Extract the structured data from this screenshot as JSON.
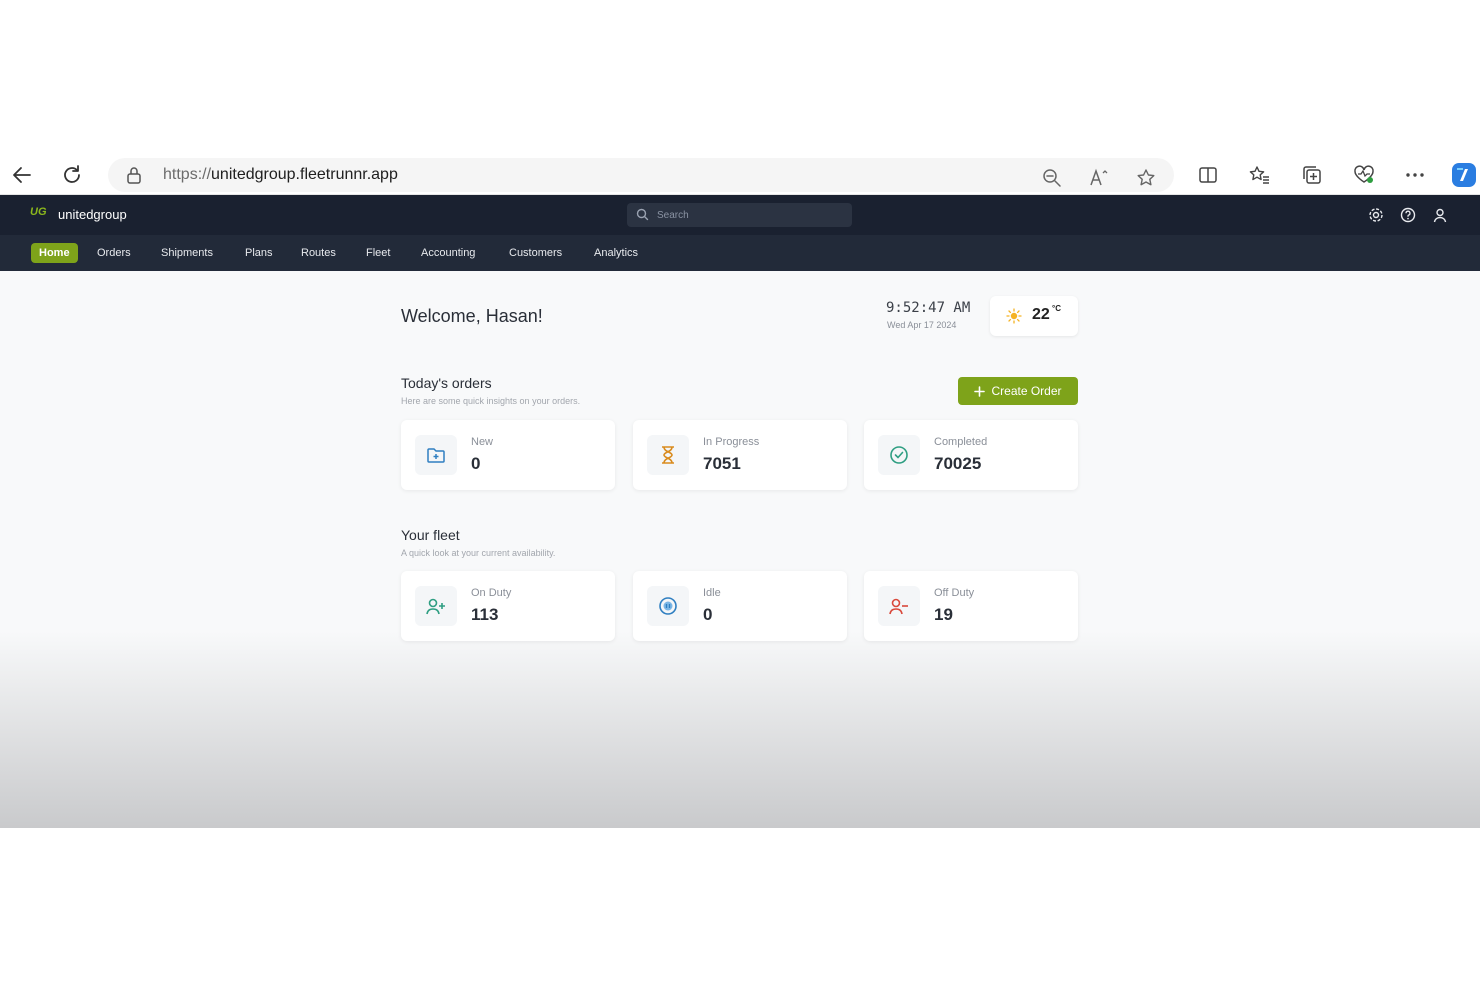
{
  "browser": {
    "url_scheme": "https://",
    "url_host": "unitedgroup.fleetrunnr.app"
  },
  "app": {
    "logo_text": "UG",
    "brand": "unitedgroup",
    "search_placeholder": "Search"
  },
  "nav": {
    "items": [
      {
        "label": "Home",
        "active": true
      },
      {
        "label": "Orders",
        "active": false
      },
      {
        "label": "Shipments",
        "active": false
      },
      {
        "label": "Plans",
        "active": false
      },
      {
        "label": "Routes",
        "active": false
      },
      {
        "label": "Fleet",
        "active": false
      },
      {
        "label": "Accounting",
        "active": false
      },
      {
        "label": "Customers",
        "active": false
      },
      {
        "label": "Analytics",
        "active": false
      }
    ]
  },
  "dashboard": {
    "welcome": "Welcome, Hasan!",
    "time": "9:52:47 AM",
    "date": "Wed Apr 17 2024",
    "weather": {
      "temp": "22",
      "unit": "°C",
      "icon": "sun-icon"
    },
    "orders": {
      "title": "Today's orders",
      "subtitle": "Here are some quick insights on your orders.",
      "create_label": "Create Order",
      "cards": [
        {
          "label": "New",
          "value": "0",
          "icon": "folder-plus-icon",
          "color": "#2f7fc1"
        },
        {
          "label": "In Progress",
          "value": "7051",
          "icon": "hourglass-icon",
          "color": "#d98b1e"
        },
        {
          "label": "Completed",
          "value": "70025",
          "icon": "check-circle-icon",
          "color": "#2e9e82"
        }
      ]
    },
    "fleet": {
      "title": "Your fleet",
      "subtitle": "A quick look at your current availability.",
      "cards": [
        {
          "label": "On Duty",
          "value": "113",
          "icon": "user-plus-icon",
          "color": "#2e9e82"
        },
        {
          "label": "Idle",
          "value": "0",
          "icon": "pause-circle-icon",
          "color": "#2f7fc1"
        },
        {
          "label": "Off Duty",
          "value": "19",
          "icon": "user-minus-icon",
          "color": "#d9483b"
        }
      ]
    }
  },
  "colors": {
    "header_bg": "#1a2130",
    "nav_bg": "#222a39",
    "accent": "#7ea31a"
  }
}
